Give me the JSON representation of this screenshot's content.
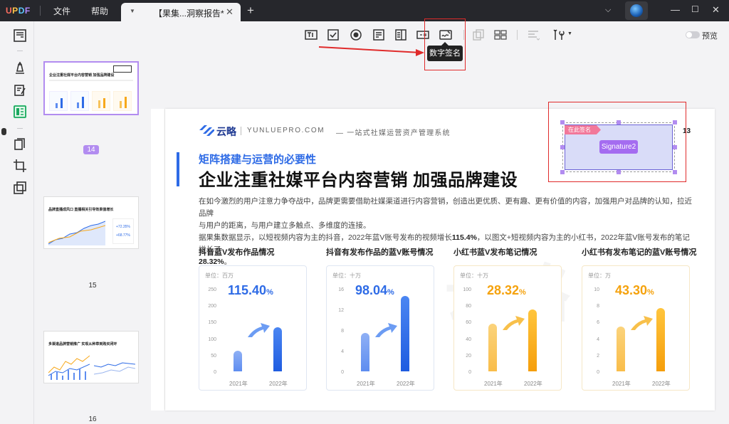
{
  "app": {
    "logo": "UPDF",
    "menu": [
      "文件",
      "帮助"
    ],
    "tab_title": "【果集...洞察报告*",
    "tab_close": "✕",
    "new_tab": "+"
  },
  "toolbar": {
    "tooltip": "数字签名",
    "preview_label": "预览"
  },
  "thumbnails": {
    "pages": [
      {
        "number": "14",
        "title": "企业注重社媒平台内容营销 加强品牌建设",
        "selected": true
      },
      {
        "number": "15",
        "title": "品牌直播成风口 直播相关引导效果值增长",
        "selected": false
      },
      {
        "number": "16",
        "title": "多渠道品牌营销推广 实现从种草到购买闭环",
        "selected": false
      }
    ]
  },
  "page": {
    "brand_cn": "云略",
    "brand_en": "YUNLUEPRO.COM",
    "slogan": "一站式社媒运营资产管理系统",
    "page_number": "13",
    "subtitle": "矩阵搭建与运营的必要性",
    "title": "企业注重社媒平台内容营销  加强品牌建设",
    "para1_line1": "在如今激烈的用户注意力争夺战中，品牌更需要借助社媒渠道进行内容营销，创造出更优质、更有趣、更有价值的内容，加强用户对品牌的认知，拉近品牌",
    "para1_line2": "与用户的距离，与用户建立多触点、多维度的连接。",
    "para2_a": "据果集数据显示，以短视频内容为主的抖音，2022年蓝V账号发布的视频增长",
    "para2_b": "115.4%",
    "para2_c": "，以图文+短视频内容为主的小红书，2022年蓝V账号发布的笔记增长了",
    "para2_d": "28.32%",
    "para2_e": "。",
    "watermark": "云略"
  },
  "signature": {
    "tag": "在此签名",
    "button": "Signature2"
  },
  "chart_data": [
    {
      "type": "bar",
      "title": "抖音蓝V发布作品情况",
      "unit": "单位：百万",
      "yticks": [
        "250",
        "200",
        "150",
        "100",
        "50",
        "0"
      ],
      "ylim": [
        0,
        250
      ],
      "categories": [
        "2021年",
        "2022年"
      ],
      "values": [
        62,
        133
      ],
      "growth_label": "115.40",
      "growth_unit": "%",
      "color": "#2e6be6"
    },
    {
      "type": "bar",
      "title": "抖音有发布作品的蓝V账号情况",
      "unit": "单位：十万",
      "yticks": [
        "16",
        "12",
        "8",
        "4",
        "0"
      ],
      "ylim": [
        0,
        16
      ],
      "categories": [
        "2021年",
        "2022年"
      ],
      "values": [
        7.4,
        14.6
      ],
      "growth_label": "98.04",
      "growth_unit": "%",
      "color": "#2e6be6"
    },
    {
      "type": "bar",
      "title": "小红书蓝V发布笔记情况",
      "unit": "单位：十万",
      "yticks": [
        "100",
        "80",
        "60",
        "40",
        "20",
        "0"
      ],
      "ylim": [
        0,
        100
      ],
      "categories": [
        "2021年",
        "2022年"
      ],
      "values": [
        58,
        75
      ],
      "growth_label": "28.32",
      "growth_unit": "%",
      "color": "#f7a81b"
    },
    {
      "type": "bar",
      "title": "小红书有发布笔记的蓝V账号情况",
      "unit": "单位：万",
      "yticks": [
        "10",
        "8",
        "6",
        "4",
        "2",
        "0"
      ],
      "ylim": [
        0,
        10
      ],
      "categories": [
        "2021年",
        "2022年"
      ],
      "values": [
        5.4,
        7.7
      ],
      "growth_label": "43.30",
      "growth_unit": "%",
      "color": "#f7a81b"
    }
  ]
}
